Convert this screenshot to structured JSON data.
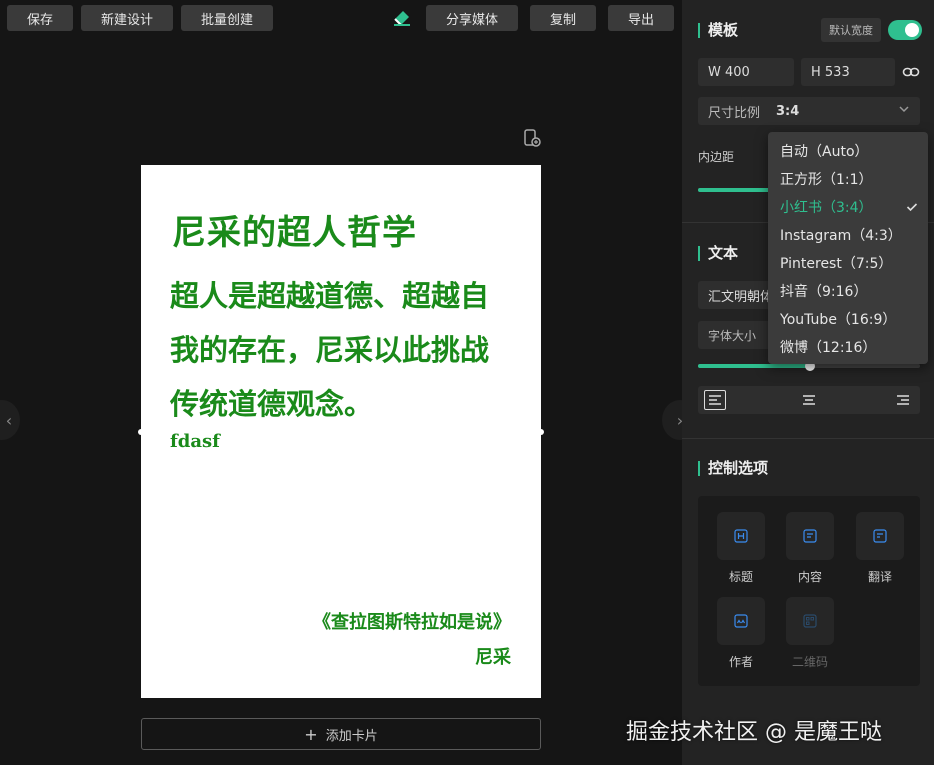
{
  "toolbar": {
    "save": "保存",
    "new_design": "新建设计",
    "batch_create": "批量创建",
    "share_media": "分享媒体",
    "copy": "复制",
    "export": "导出"
  },
  "card": {
    "title": "尼采的超人哲学",
    "body": "超人是超越道德、超越自我的存在，尼采以此挑战传统道德观念。",
    "extra": "fdasf",
    "book": "《查拉图斯特拉如是说》",
    "author": "尼采"
  },
  "add_card": "添加卡片",
  "panel": {
    "template_title": "模板",
    "default_width_label": "默认宽度",
    "width": "W 400",
    "height": "H 533",
    "ratio_label": "尺寸比例",
    "ratio_value": "3:4",
    "padding_label": "内边距",
    "text_title": "文本",
    "font_value": "汇文明朝体",
    "font_size_label": "字体大小",
    "control_title": "控制选项",
    "controls": [
      {
        "label": "标题",
        "icon": "heading-icon"
      },
      {
        "label": "内容",
        "icon": "content-icon"
      },
      {
        "label": "翻译",
        "icon": "translate-icon"
      },
      {
        "label": "作者",
        "icon": "author-icon"
      },
      {
        "label": "二维码",
        "icon": "qrcode-icon"
      }
    ]
  },
  "ratio_options": [
    "自动（Auto）",
    "正方形（1:1）",
    "小红书（3:4）",
    "Instagram（4:3）",
    "Pinterest（7:5）",
    "抖音（9:16）",
    "YouTube（16:9）",
    "微博（12:16）"
  ],
  "ratio_selected": "小红书（3:4）",
  "watermark": "掘金技术社区 @ 是魔王哒",
  "colors": {
    "accent": "#2fbf8f",
    "card_text": "#1a8a1a"
  }
}
